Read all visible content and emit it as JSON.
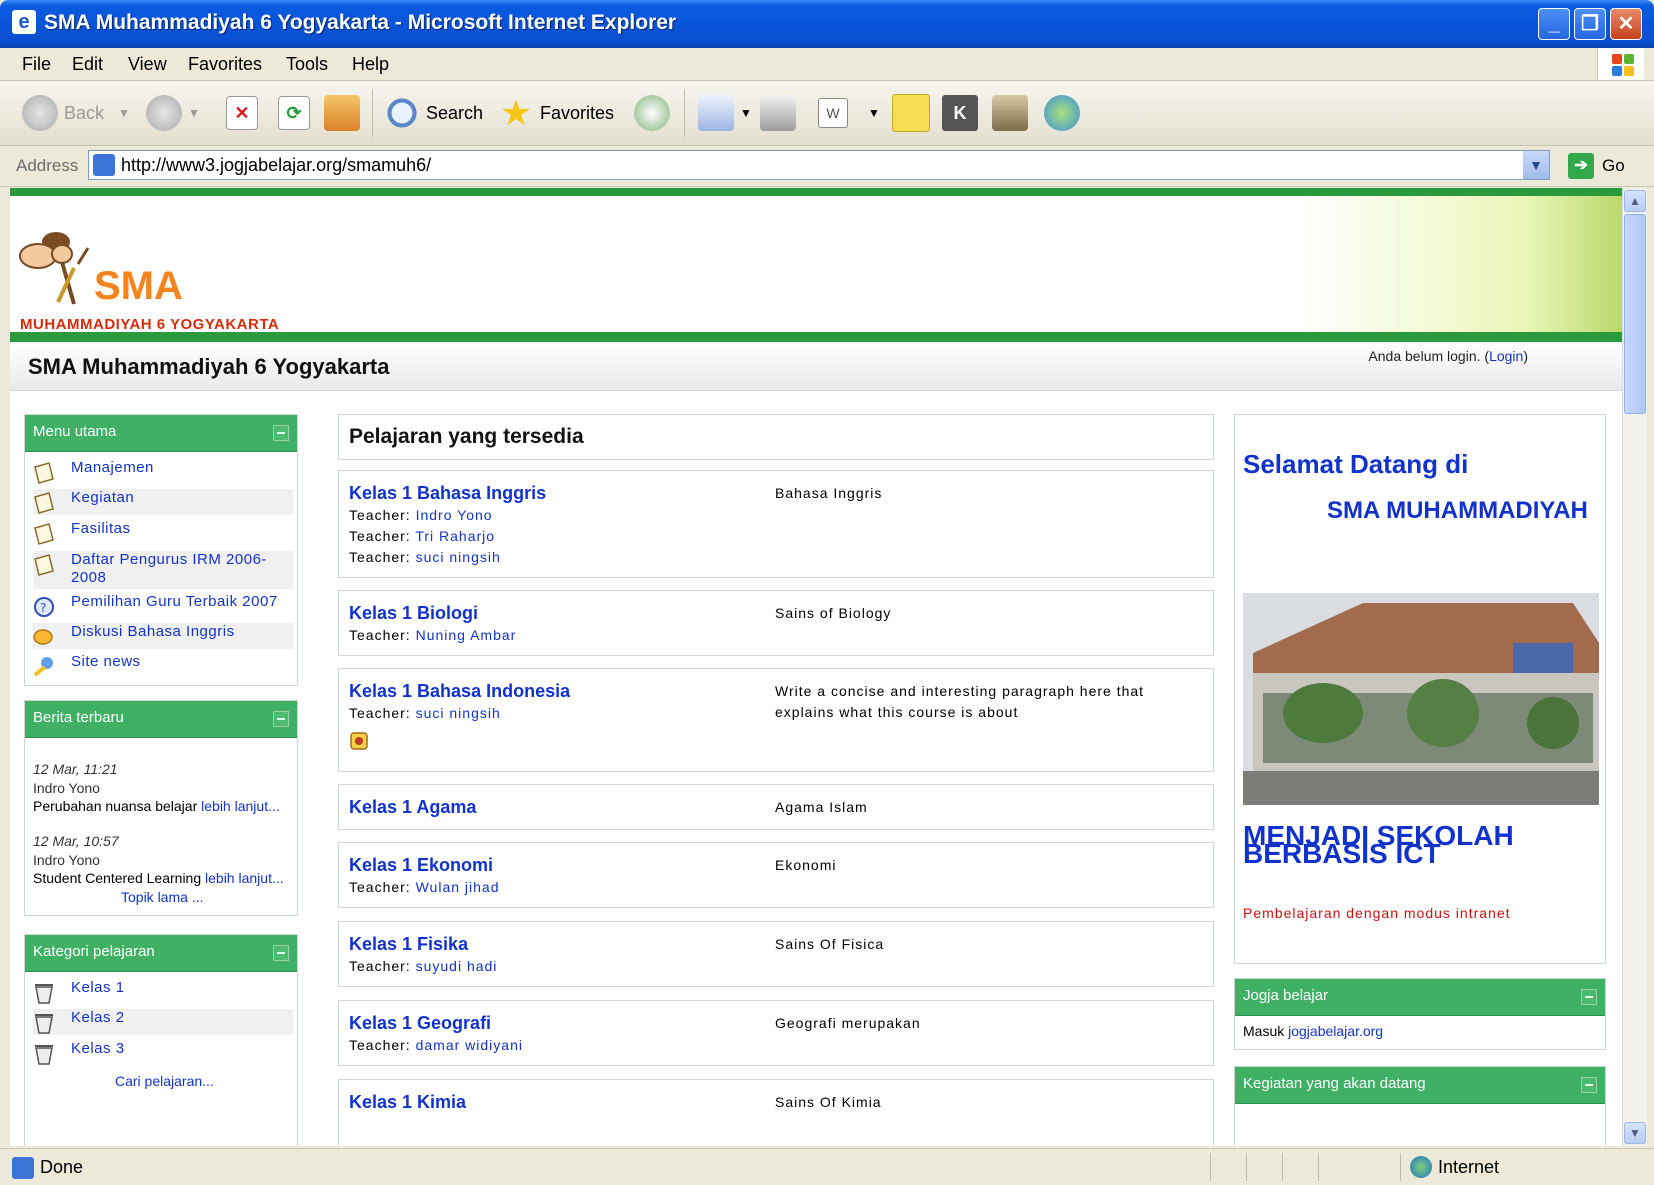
{
  "window": {
    "title": "SMA Muhammadiyah 6 Yogyakarta - Microsoft Internet Explorer"
  },
  "menubar": [
    "File",
    "Edit",
    "View",
    "Favorites",
    "Tools",
    "Help"
  ],
  "toolbar": {
    "back": "Back",
    "search": "Search",
    "favorites": "Favorites"
  },
  "address": {
    "label": "Address",
    "url": "http://www3.jogjabelajar.org/smamuh6/",
    "go": "Go"
  },
  "status": {
    "text": "Done",
    "zone": "Internet"
  },
  "site": {
    "logo_text": "SMA",
    "logo_sub": "MUHAMMADIYAH 6 YOGYAKARTA",
    "name": "SMA Muhammadiyah 6 Yogyakarta",
    "login_prefix": "Anda belum login. (",
    "login_link": "Login",
    "login_suffix": ")"
  },
  "menu_utama": {
    "title": "Menu utama",
    "items": [
      "Manajemen",
      "Kegiatan",
      "Fasilitas",
      "Daftar Pengurus IRM 2006-2008",
      "Pemilihan Guru Terbaik 2007",
      "Diskusi Bahasa Inggris",
      "Site news"
    ]
  },
  "berita": {
    "title": "Berita terbaru",
    "items": [
      {
        "date": "12 Mar, 11:21",
        "author": "Indro Yono",
        "text": "Perubahan nuansa belajar ",
        "more": "lebih lanjut..."
      },
      {
        "date": "12 Mar, 10:57",
        "author": "Indro Yono",
        "text": "Student Centered Learning ",
        "more": "lebih lanjut..."
      }
    ],
    "older": "Topik lama ..."
  },
  "kategori": {
    "title": "Kategori pelajaran",
    "items": [
      "Kelas 1",
      "Kelas 2",
      "Kelas 3"
    ],
    "search": "Cari pelajaran..."
  },
  "courses": {
    "heading": "Pelajaran yang tersedia",
    "teacher_label": "Teacher: ",
    "list": [
      {
        "name": "Kelas 1 Bahasa Inggris",
        "teachers": [
          "Indro Yono",
          "Tri Raharjo",
          "suci ningsih"
        ],
        "desc": "Bahasa Inggris"
      },
      {
        "name": "Kelas 1 Biologi",
        "teachers": [
          "Nuning Ambar"
        ],
        "desc": "Sains of Biology"
      },
      {
        "name": "Kelas 1 Bahasa Indonesia",
        "teachers": [
          "suci ningsih"
        ],
        "desc": "Write a concise and interesting paragraph here that explains what this course is about"
      },
      {
        "name": "Kelas 1 Agama",
        "teachers": [],
        "desc": "Agama Islam"
      },
      {
        "name": "Kelas 1 Ekonomi",
        "teachers": [
          "Wulan jihad"
        ],
        "desc": "Ekonomi"
      },
      {
        "name": "Kelas 1 Fisika",
        "teachers": [
          "suyudi hadi"
        ],
        "desc": "Sains Of Fisica"
      },
      {
        "name": "Kelas 1 Geografi",
        "teachers": [
          "damar widiyani"
        ],
        "desc": "Geografi merupakan"
      },
      {
        "name": "Kelas 1 Kimia",
        "teachers": [],
        "desc": "Sains Of Kimia"
      }
    ]
  },
  "welcome": {
    "line1": "Selamat Datang di",
    "line2": "SMA MUHAMMADIYAH",
    "line3": "MENJADI SEKOLAH BERBASIS ICT",
    "tagline": "Pembelajaran dengan modus intranet"
  },
  "jogja": {
    "title": "Jogja belajar",
    "prefix": "Masuk ",
    "link": "jogjabelajar.org"
  },
  "kegiatan": {
    "title": "Kegiatan yang akan datang"
  },
  "colors": {
    "green": "#3fb064",
    "link": "#1133cc",
    "xp_blue": "#0854d8",
    "logo_orange": "#f5841f",
    "logo_red": "#d62c0b"
  }
}
